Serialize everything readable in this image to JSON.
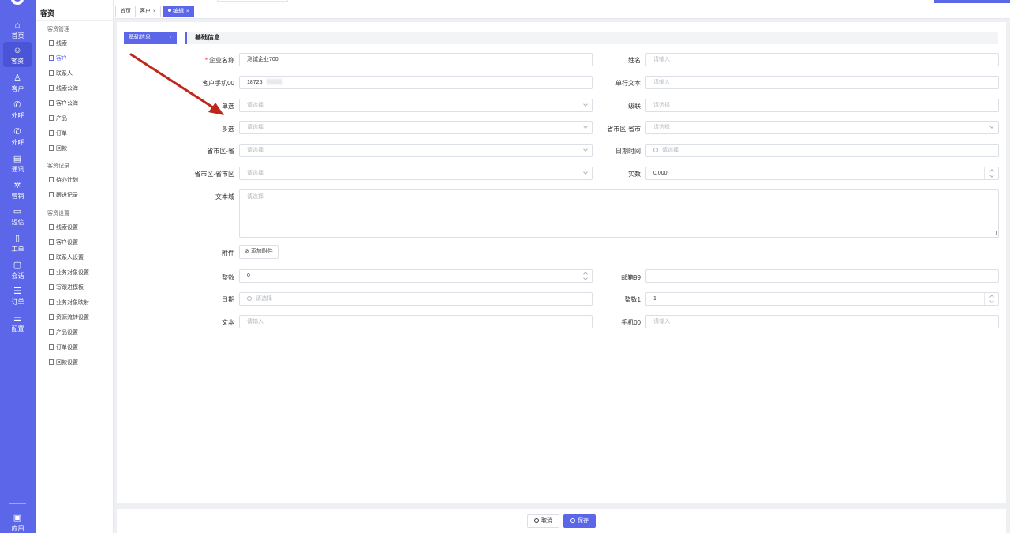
{
  "rail": {
    "items": [
      {
        "label": "首页",
        "icon": "home-icon",
        "glyph": "⌂"
      },
      {
        "label": "客资",
        "icon": "users-icon",
        "glyph": "☺",
        "active": true
      },
      {
        "label": "客户",
        "icon": "user-icon",
        "glyph": "♙"
      },
      {
        "label": "外呼",
        "icon": "phone-icon",
        "glyph": "✆"
      },
      {
        "label": "外呼",
        "icon": "phone-plus-icon",
        "glyph": "✆"
      },
      {
        "label": "通讯",
        "icon": "contacts-icon",
        "glyph": "▤"
      },
      {
        "label": "营销",
        "icon": "gear-icon",
        "glyph": "✲"
      },
      {
        "label": "短信",
        "icon": "sms-icon",
        "glyph": "▭"
      },
      {
        "label": "工单",
        "icon": "clipboard-icon",
        "glyph": "▯"
      },
      {
        "label": "会话",
        "icon": "chat-icon",
        "glyph": "▢"
      },
      {
        "label": "订单",
        "icon": "order-icon",
        "glyph": "☰"
      },
      {
        "label": "配置",
        "icon": "sliders-icon",
        "glyph": "⚌"
      }
    ],
    "bottom": {
      "label": "应用",
      "icon": "apps-icon",
      "glyph": "▣"
    }
  },
  "sidebar": {
    "title": "客资",
    "groups": [
      {
        "title": "客资管理",
        "items": [
          "线索",
          "客户",
          "联系人",
          "线索公海",
          "客户公海",
          "产品",
          "订单",
          "回款"
        ]
      },
      {
        "title": "客资记录",
        "items": [
          "待办计划",
          "跟进记录"
        ]
      },
      {
        "title": "客资设置",
        "items": [
          "线索设置",
          "客户设置",
          "联系人设置",
          "业务对象设置",
          "写跟进模板",
          "业务对象映射",
          "资源流转设置",
          "产品设置",
          "订单设置",
          "回款设置"
        ]
      }
    ],
    "active_item": "客户"
  },
  "tabs": [
    {
      "label": "首页"
    },
    {
      "label": "客户",
      "close": "×"
    },
    {
      "label": "编辑",
      "close": "×",
      "active": true
    }
  ],
  "form": {
    "step_label": "基础信息",
    "step_chevron": "›",
    "section_title": "基础信息",
    "fields": {
      "company_name": {
        "label": "企业名称",
        "required": "*",
        "value": "测试企业700"
      },
      "name": {
        "label": "姓名",
        "placeholder": "请输入"
      },
      "mobile00": {
        "label": "客户手机00",
        "value": "18725"
      },
      "single_text": {
        "label": "单行文本",
        "placeholder": "请输入"
      },
      "single_select": {
        "label": "单选",
        "placeholder": "请选择"
      },
      "cascade": {
        "label": "级联",
        "placeholder": "请选择"
      },
      "multi_select": {
        "label": "多选",
        "placeholder": "请选择"
      },
      "region_city": {
        "label": "省市区-省市",
        "placeholder": "请选择"
      },
      "region_province": {
        "label": "省市区-省",
        "placeholder": "请选择"
      },
      "datetime": {
        "label": "日期时间",
        "placeholder": "请选择"
      },
      "region_full": {
        "label": "省市区-省市区",
        "placeholder": "请选择"
      },
      "real_number": {
        "label": "实数",
        "value": "0.000"
      },
      "textarea": {
        "label": "文本域",
        "placeholder": "请选择"
      },
      "attachment": {
        "label": "附件",
        "button": "添加附件",
        "icon": "paperclip-icon"
      },
      "integer": {
        "label": "整数",
        "value": "0"
      },
      "email99": {
        "label": "邮箱99",
        "value": ""
      },
      "date": {
        "label": "日期",
        "placeholder": "请选择"
      },
      "integer1": {
        "label": "整数1",
        "value": "1"
      },
      "text": {
        "label": "文本",
        "placeholder": "请输入"
      },
      "mobile00b": {
        "label": "手机00",
        "placeholder": "请输入"
      }
    }
  },
  "footer": {
    "cancel": "取消",
    "save": "保存"
  },
  "colors": {
    "brand": "#5b67e8",
    "annotation_arrow": "#c0271c"
  }
}
